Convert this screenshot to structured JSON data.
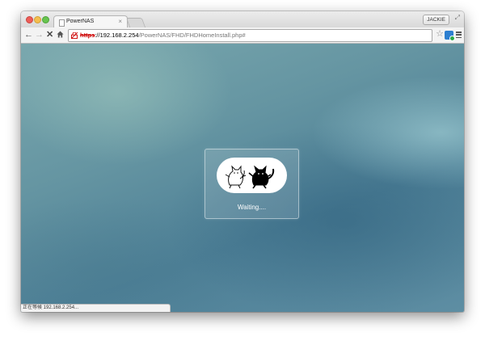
{
  "browser": {
    "tab": {
      "title": "PowerNAS",
      "close_label": "×"
    },
    "user_button": "JACKIE",
    "url": {
      "scheme": "https",
      "host": "://192.168.2.254",
      "path": "/PowerNAS/FHD/FHDHomeInstall.php#"
    },
    "status_text": "正在等候 192.168.2.254..."
  },
  "loader": {
    "message": "Waiting...."
  },
  "colors": {
    "accent_link_red": "#cc0000",
    "backdrop": "#5e8ea3"
  },
  "icons": [
    "back-arrow-icon",
    "forward-arrow-icon",
    "stop-icon",
    "home-icon",
    "lock-broken-icon",
    "star-icon",
    "extension-icon",
    "menu-icon"
  ]
}
